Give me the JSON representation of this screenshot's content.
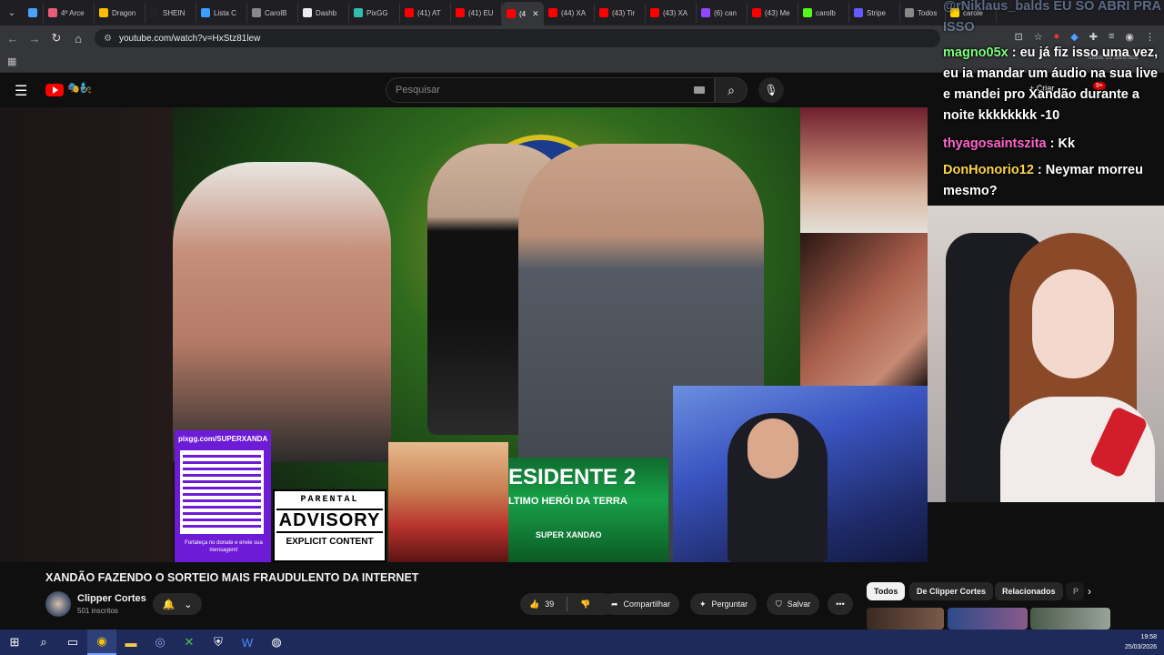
{
  "browser": {
    "tabs": [
      {
        "label": "",
        "icon": "diamond-icon",
        "color": "#4aa3ff"
      },
      {
        "label": "4º Arce",
        "icon": "spark-icon",
        "color": "#e85d75"
      },
      {
        "label": "Dragon",
        "icon": "drive-icon",
        "color": "#fbbc04"
      },
      {
        "label": "SHEIN",
        "icon": "s-icon",
        "color": "#222222"
      },
      {
        "label": "Lista C",
        "icon": "cloud-icon",
        "color": "#3aa0ff"
      },
      {
        "label": "CarolB",
        "icon": "globe-icon",
        "color": "#888888"
      },
      {
        "label": "Dashb",
        "icon": "circle-icon",
        "color": "#eeeeee"
      },
      {
        "label": "PixGG",
        "icon": "pix-icon",
        "color": "#32bcad"
      },
      {
        "label": "(41) AT",
        "icon": "youtube-icon",
        "color": "#ff0000"
      },
      {
        "label": "(41) EU",
        "icon": "youtube-icon",
        "color": "#ff0000"
      },
      {
        "label": "(4",
        "icon": "youtube-icon",
        "color": "#ff0000",
        "active": true
      },
      {
        "label": "(44) XA",
        "icon": "youtube-icon",
        "color": "#ff0000"
      },
      {
        "label": "(43) Tir",
        "icon": "youtube-icon",
        "color": "#ff0000"
      },
      {
        "label": "(43) XA",
        "icon": "youtube-icon",
        "color": "#ff0000"
      },
      {
        "label": "(6) can",
        "icon": "twitch-icon",
        "color": "#9146ff"
      },
      {
        "label": "(43) Me",
        "icon": "youtube-icon",
        "color": "#ff0000"
      },
      {
        "label": "carolb",
        "icon": "k-icon",
        "color": "#53fc18"
      },
      {
        "label": "Stripe",
        "icon": "stripe-icon",
        "color": "#635bff"
      },
      {
        "label": "Todos",
        "icon": "globe-icon",
        "color": "#888888"
      },
      {
        "label": "carole",
        "icon": "star-icon",
        "color": "#ffd400"
      }
    ],
    "url": "youtube.com/watch?v=HxStz81lew"
  },
  "bookmarks": {
    "all_favorites": "Todos os favoritos"
  },
  "youtube": {
    "search_placeholder": "Pesquisar",
    "create_label": "Criar",
    "notif_count": "9+"
  },
  "thumbnail": {
    "qr_url": "pixgg.com/SUPERXANDA",
    "qr_caption": "Fortaleça no donate e envie sua mensagem!",
    "parental_line1": "PARENTAL",
    "parental_line2": "ADVISORY",
    "parental_line3": "EXPLICIT CONTENT",
    "presidente_title": "ESIDENTE 2",
    "presidente_sub": "LTIMO HERÓI DA TERRA",
    "presidente_brand": "SUPER XANDAO"
  },
  "chat": {
    "messages": [
      {
        "user": "@rNiklaus_balds",
        "text": "EU SO ABRI PRA ISSO",
        "color": "#8fa8d8"
      },
      {
        "user": "magno05x",
        "text": ": eu já fiz isso uma vez, eu ia mandar um áudio na sua live e mandei pro Xandão durante a noite kkkkkkkk -10",
        "color": "#7cfc7c"
      },
      {
        "user": "thyagosaintszita",
        "text": ": Kk",
        "color": "#ff66cc"
      },
      {
        "user": "DonHonorio12",
        "text": ": Neymar morreu mesmo?",
        "color": "#ffd54a"
      }
    ]
  },
  "video": {
    "title": "XANDÃO FAZENDO O SORTEIO MAIS FRAUDULENTO DA INTERNET",
    "channel": "Clipper Cortes",
    "subscribers": "501 inscritos",
    "likes": "39",
    "share_label": "Compartilhar",
    "ask_label": "Perguntar",
    "save_label": "Salvar"
  },
  "filters": {
    "chips": [
      "Todos",
      "De Clipper Cortes",
      "Relacionados",
      "P"
    ]
  },
  "taskbar": {
    "time": "19:58",
    "date": "25/03/2026"
  }
}
